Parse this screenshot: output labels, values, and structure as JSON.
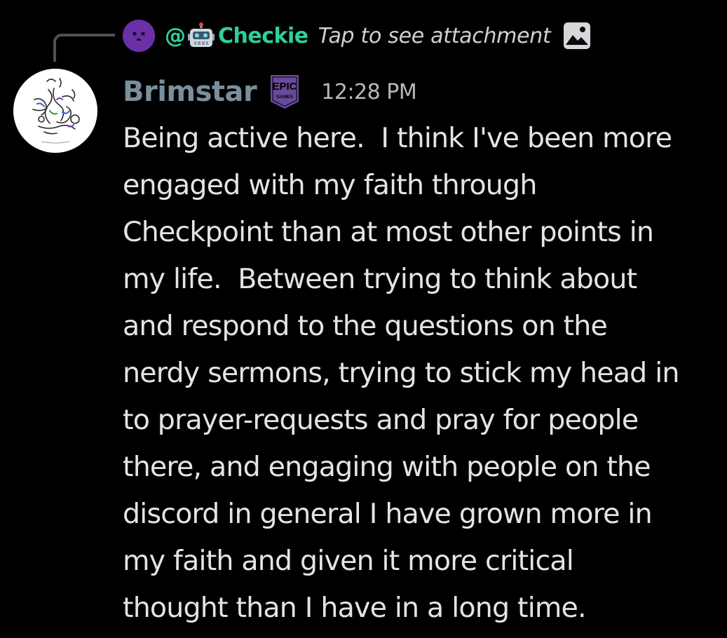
{
  "reply": {
    "at_symbol": "@",
    "bot_emoji": "robot-emoji",
    "username": "Checkie",
    "attachment_text": "Tap to see attachment",
    "attachment_icon": "image-icon",
    "avatar_color": "#6b2fa8"
  },
  "message": {
    "author": "Brimstar",
    "author_color": "#7a8f9c",
    "role_badge": {
      "top": "EPIC",
      "bottom": "GAMES",
      "color": "#6a4a9c"
    },
    "timestamp": "12:28 PM",
    "lines": [
      "Being active here.  I think I've been more",
      "engaged with my faith through",
      "Checkpoint than at most other points in",
      "my life.  Between trying to think about",
      "and respond to the questions on the",
      "nerdy sermons, trying to stick my head in",
      "to prayer-requests and pray for people",
      "there, and engaging with people on the",
      "discord in general I have grown more in",
      "my faith and given it more critical",
      "thought than I have in a long time."
    ]
  },
  "colors": {
    "background": "#000000",
    "reply_name": "#2fcf9a",
    "text": "#e3e4e6",
    "muted": "#b5b7bc"
  }
}
